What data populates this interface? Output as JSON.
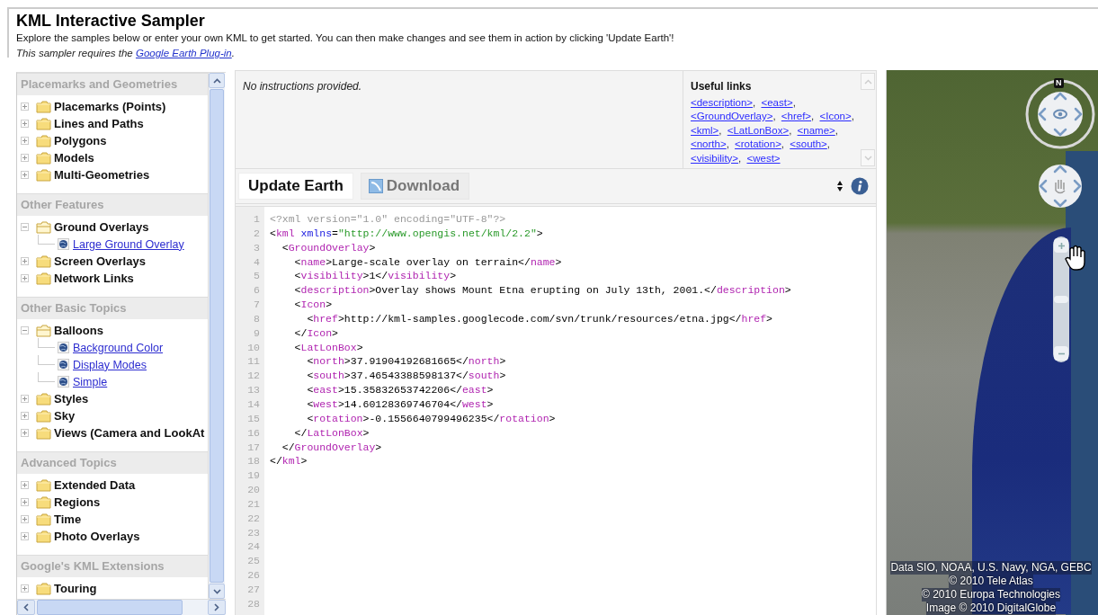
{
  "header": {
    "title": "KML Interactive Sampler",
    "intro": "Explore the samples below or enter your own KML to get started. You can then make changes and see them in action by clicking 'Update Earth'!",
    "requirement": {
      "text": "This sampler requires the ",
      "link": "Google Earth Plug-in",
      "after": "."
    }
  },
  "sidebar": {
    "sections": [
      {
        "title": "Placemarks and Geometries",
        "items": [
          {
            "label": "Placemarks (Points)",
            "expanded": false
          },
          {
            "label": "Lines and Paths",
            "expanded": false
          },
          {
            "label": "Polygons",
            "expanded": false
          },
          {
            "label": "Models",
            "expanded": false
          },
          {
            "label": "Multi-Geometries",
            "expanded": false
          }
        ]
      },
      {
        "title": "Other Features",
        "items": [
          {
            "label": "Ground Overlays",
            "expanded": true,
            "children": [
              {
                "label": "Large Ground Overlay"
              }
            ]
          },
          {
            "label": "Screen Overlays",
            "expanded": false
          },
          {
            "label": "Network Links",
            "expanded": false
          }
        ]
      },
      {
        "title": "Other Basic Topics",
        "items": [
          {
            "label": "Balloons",
            "expanded": true,
            "children": [
              {
                "label": "Background Color"
              },
              {
                "label": "Display Modes"
              },
              {
                "label": "Simple"
              }
            ]
          },
          {
            "label": "Styles",
            "expanded": false
          },
          {
            "label": "Sky",
            "expanded": false
          },
          {
            "label": "Views (Camera and LookAt",
            "expanded": false
          }
        ]
      },
      {
        "title": "Advanced Topics",
        "items": [
          {
            "label": "Extended Data",
            "expanded": false
          },
          {
            "label": "Regions",
            "expanded": false
          },
          {
            "label": "Time",
            "expanded": false
          },
          {
            "label": "Photo Overlays",
            "expanded": false
          }
        ]
      },
      {
        "title": "Google's KML Extensions",
        "items": [
          {
            "label": "Touring",
            "expanded": false
          }
        ]
      }
    ]
  },
  "instructions": {
    "text": "No instructions provided.",
    "links_title": "Useful links",
    "links": [
      {
        "text": "<description>",
        "separator": ","
      },
      {
        "text": "<east>",
        "separator": ","
      },
      {
        "text": "<GroundOverlay>",
        "separator": ","
      },
      {
        "text": "<href>",
        "separator": ","
      },
      {
        "text": "<Icon>",
        "separator": ","
      },
      {
        "text": "<kml>",
        "separator": ","
      },
      {
        "text": "<LatLonBox>",
        "separator": ","
      },
      {
        "text": "<name>",
        "separator": ","
      },
      {
        "text": "<north>",
        "separator": ","
      },
      {
        "text": "<rotation>",
        "separator": ","
      },
      {
        "text": "<south>",
        "separator": ","
      },
      {
        "text": "<visibility>",
        "separator": ","
      },
      {
        "text": "<west>"
      }
    ]
  },
  "toolbar": {
    "update_button": "Update Earth",
    "download_button": "Download"
  },
  "editor": {
    "lines": [
      {
        "number": "1",
        "tokens": [
          {
            "kind": "decl",
            "text": "<?xml version=\"1.0\" encoding=\"UTF-8\"?>"
          }
        ]
      },
      {
        "number": "2",
        "tokens": [
          {
            "kind": "text",
            "text": "<"
          },
          {
            "kind": "tag",
            "text": "kml"
          },
          {
            "kind": "attr",
            "text": " xmlns"
          },
          {
            "kind": "text",
            "text": "="
          },
          {
            "kind": "string",
            "text": "\"http://www.opengis.net/kml/2.2\""
          },
          {
            "kind": "text",
            "text": ">"
          }
        ]
      },
      {
        "number": "3",
        "tokens": [
          {
            "kind": "text",
            "text": "  <"
          },
          {
            "kind": "tag",
            "text": "GroundOverlay"
          },
          {
            "kind": "text",
            "text": ">"
          }
        ]
      },
      {
        "number": "4",
        "tokens": [
          {
            "kind": "text",
            "text": "    <"
          },
          {
            "kind": "tag",
            "text": "name"
          },
          {
            "kind": "text",
            "text": ">Large-scale overlay on terrain</"
          },
          {
            "kind": "tag",
            "text": "name"
          },
          {
            "kind": "text",
            "text": ">"
          }
        ]
      },
      {
        "number": "5",
        "tokens": [
          {
            "kind": "text",
            "text": "    <"
          },
          {
            "kind": "tag",
            "text": "visibility"
          },
          {
            "kind": "text",
            "text": ">1</"
          },
          {
            "kind": "tag",
            "text": "visibility"
          },
          {
            "kind": "text",
            "text": ">"
          }
        ]
      },
      {
        "number": "6",
        "tokens": [
          {
            "kind": "text",
            "text": "    <"
          },
          {
            "kind": "tag",
            "text": "description"
          },
          {
            "kind": "text",
            "text": ">Overlay shows Mount Etna erupting on July 13th, 2001.</"
          },
          {
            "kind": "tag",
            "text": "description"
          },
          {
            "kind": "text",
            "text": ">"
          }
        ]
      },
      {
        "number": "7",
        "tokens": [
          {
            "kind": "text",
            "text": "    <"
          },
          {
            "kind": "tag",
            "text": "Icon"
          },
          {
            "kind": "text",
            "text": ">"
          }
        ]
      },
      {
        "number": "8",
        "tokens": [
          {
            "kind": "text",
            "text": "      <"
          },
          {
            "kind": "tag",
            "text": "href"
          },
          {
            "kind": "text",
            "text": ">http://kml-samples.googlecode.com/svn/trunk/resources/etna.jpg</"
          },
          {
            "kind": "tag",
            "text": "href"
          },
          {
            "kind": "text",
            "text": ">"
          }
        ]
      },
      {
        "number": "9",
        "tokens": [
          {
            "kind": "text",
            "text": "    </"
          },
          {
            "kind": "tag",
            "text": "Icon"
          },
          {
            "kind": "text",
            "text": ">"
          }
        ]
      },
      {
        "number": "10",
        "tokens": [
          {
            "kind": "text",
            "text": "    <"
          },
          {
            "kind": "tag",
            "text": "LatLonBox"
          },
          {
            "kind": "text",
            "text": ">"
          }
        ]
      },
      {
        "number": "11",
        "tokens": [
          {
            "kind": "text",
            "text": "      <"
          },
          {
            "kind": "tag",
            "text": "north"
          },
          {
            "kind": "text",
            "text": ">37.91904192681665</"
          },
          {
            "kind": "tag",
            "text": "north"
          },
          {
            "kind": "text",
            "text": ">"
          }
        ]
      },
      {
        "number": "12",
        "tokens": [
          {
            "kind": "text",
            "text": "      <"
          },
          {
            "kind": "tag",
            "text": "south"
          },
          {
            "kind": "text",
            "text": ">37.46543388598137</"
          },
          {
            "kind": "tag",
            "text": "south"
          },
          {
            "kind": "text",
            "text": ">"
          }
        ]
      },
      {
        "number": "13",
        "tokens": [
          {
            "kind": "text",
            "text": "      <"
          },
          {
            "kind": "tag",
            "text": "east"
          },
          {
            "kind": "text",
            "text": ">15.35832653742206</"
          },
          {
            "kind": "tag",
            "text": "east"
          },
          {
            "kind": "text",
            "text": ">"
          }
        ]
      },
      {
        "number": "14",
        "tokens": [
          {
            "kind": "text",
            "text": "      <"
          },
          {
            "kind": "tag",
            "text": "west"
          },
          {
            "kind": "text",
            "text": ">14.60128369746704</"
          },
          {
            "kind": "tag",
            "text": "west"
          },
          {
            "kind": "text",
            "text": ">"
          }
        ]
      },
      {
        "number": "15",
        "tokens": [
          {
            "kind": "text",
            "text": "      <"
          },
          {
            "kind": "tag",
            "text": "rotation"
          },
          {
            "kind": "text",
            "text": ">-0.1556640799496235</"
          },
          {
            "kind": "tag",
            "text": "rotation"
          },
          {
            "kind": "text",
            "text": ">"
          }
        ]
      },
      {
        "number": "16",
        "tokens": [
          {
            "kind": "text",
            "text": "    </"
          },
          {
            "kind": "tag",
            "text": "LatLonBox"
          },
          {
            "kind": "text",
            "text": ">"
          }
        ]
      },
      {
        "number": "17",
        "tokens": [
          {
            "kind": "text",
            "text": "  </"
          },
          {
            "kind": "tag",
            "text": "GroundOverlay"
          },
          {
            "kind": "text",
            "text": ">"
          }
        ]
      },
      {
        "number": "18",
        "tokens": [
          {
            "kind": "text",
            "text": "</"
          },
          {
            "kind": "tag",
            "text": "kml"
          },
          {
            "kind": "text",
            "text": ">"
          }
        ]
      },
      {
        "number": "19"
      },
      {
        "number": "20"
      },
      {
        "number": "21"
      },
      {
        "number": "22"
      },
      {
        "number": "23"
      },
      {
        "number": "24"
      },
      {
        "number": "25"
      },
      {
        "number": "26"
      },
      {
        "number": "27"
      },
      {
        "number": "28"
      }
    ]
  },
  "map": {
    "compass_label": "N",
    "zoom": {
      "level": 0.5
    },
    "attribution": [
      "Data SIO, NOAA, U.S. Navy, NGA, GEBC",
      "© 2010 Tele Atlas",
      "© 2010 Europa Technologies",
      "Image © 2010 DigitalGlobe"
    ]
  }
}
